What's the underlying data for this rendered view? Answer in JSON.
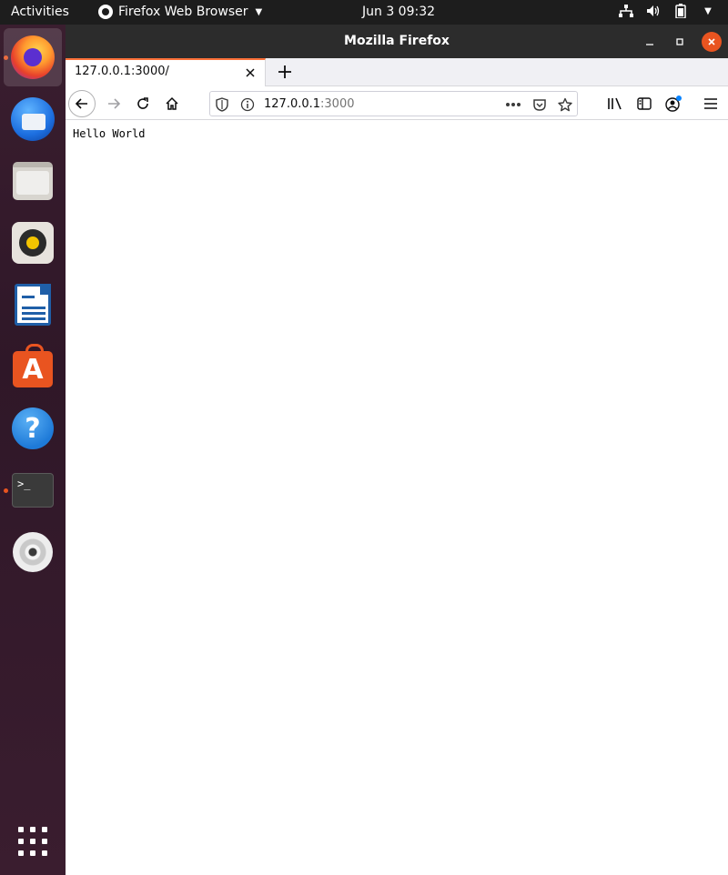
{
  "topbar": {
    "activities": "Activities",
    "app_name": "Firefox Web Browser",
    "clock": "Jun 3  09:32"
  },
  "dock": {
    "items": [
      "firefox",
      "thunderbird",
      "files",
      "rhythmbox",
      "libreoffice-writer",
      "ubuntu-software",
      "help",
      "terminal",
      "dvd"
    ],
    "running": [
      "firefox",
      "terminal"
    ],
    "active": "firefox",
    "terminal_prompt": ">_"
  },
  "window": {
    "title": "Mozilla Firefox"
  },
  "browser": {
    "tab": {
      "title": "127.0.0.1:3000/"
    },
    "url": {
      "host": "127.0.0.1",
      "port": ":3000"
    }
  },
  "page": {
    "text": "Hello World"
  },
  "colors": {
    "accent": "#e95420",
    "tab_highlight": "#ff7139",
    "topbar": "#1d1d1d",
    "titlebar": "#2c2c2c"
  }
}
